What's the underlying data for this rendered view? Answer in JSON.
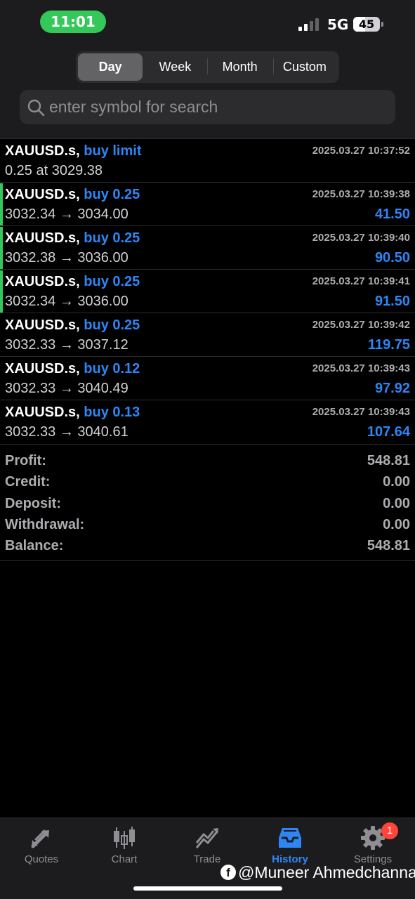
{
  "status_bar": {
    "time": "11:01",
    "network": "5G",
    "battery": "45",
    "battery_level": 0.45
  },
  "period_tabs": [
    {
      "label": "Day",
      "active": true
    },
    {
      "label": "Week",
      "active": false
    },
    {
      "label": "Month",
      "active": false
    },
    {
      "label": "Custom",
      "active": false
    }
  ],
  "search": {
    "placeholder": "enter symbol for search"
  },
  "order": {
    "symbol": "XAUUSD.s,",
    "action": "buy limit",
    "time": "2025.03.27 10:37:52",
    "detail": "0.25 at 3029.38"
  },
  "deals": [
    {
      "symbol": "XAUUSD.s,",
      "action": "buy 0.25",
      "time": "2025.03.27 10:39:38",
      "prices": "3032.34 → 3034.00",
      "profit": "41.50",
      "accent": true
    },
    {
      "symbol": "XAUUSD.s,",
      "action": "buy 0.25",
      "time": "2025.03.27 10:39:40",
      "prices": "3032.38 → 3036.00",
      "profit": "90.50",
      "accent": true
    },
    {
      "symbol": "XAUUSD.s,",
      "action": "buy 0.25",
      "time": "2025.03.27 10:39:41",
      "prices": "3032.34 → 3036.00",
      "profit": "91.50",
      "accent": true
    },
    {
      "symbol": "XAUUSD.s,",
      "action": "buy 0.25",
      "time": "2025.03.27 10:39:42",
      "prices": "3032.33 → 3037.12",
      "profit": "119.75",
      "accent": false
    },
    {
      "symbol": "XAUUSD.s,",
      "action": "buy 0.12",
      "time": "2025.03.27 10:39:43",
      "prices": "3032.33 → 3040.49",
      "profit": "97.92",
      "accent": false
    },
    {
      "symbol": "XAUUSD.s,",
      "action": "buy 0.13",
      "time": "2025.03.27 10:39:43",
      "prices": "3032.33 → 3040.61",
      "profit": "107.64",
      "accent": false
    }
  ],
  "summary": [
    {
      "label": "Profit:",
      "value": "548.81"
    },
    {
      "label": "Credit:",
      "value": "0.00"
    },
    {
      "label": "Deposit:",
      "value": "0.00"
    },
    {
      "label": "Withdrawal:",
      "value": "0.00"
    },
    {
      "label": "Balance:",
      "value": "548.81"
    }
  ],
  "tabbar": {
    "items": [
      {
        "label": "Quotes",
        "icon": "quotes-arrows-icon"
      },
      {
        "label": "Chart",
        "icon": "candlestick-icon"
      },
      {
        "label": "Trade",
        "icon": "trend-icon"
      },
      {
        "label": "History",
        "icon": "inbox-icon",
        "active": true
      },
      {
        "label": "Settings",
        "icon": "gear-icon"
      }
    ],
    "settings_badge": "1"
  },
  "watermark": {
    "text": "@Muneer Ahmedchanna",
    "icon": "facebook-icon"
  },
  "colors": {
    "accent_blue": "#2d86f5",
    "green": "#34c759",
    "badge_red": "#ff453a",
    "background": "#000000",
    "header_bg": "#1c1c1e"
  }
}
